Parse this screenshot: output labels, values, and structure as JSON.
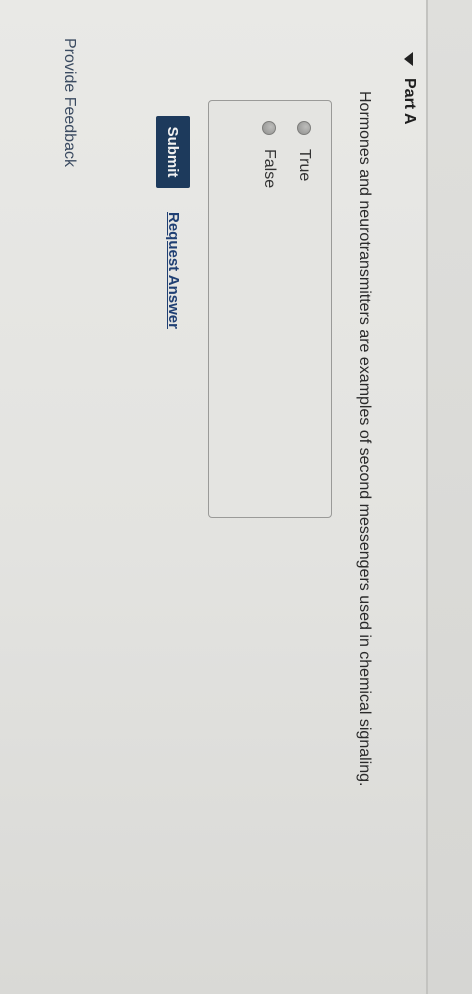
{
  "part": {
    "title": "Part A",
    "question": "Hormones and neurotransmitters are examples of second messengers used in chemical signaling."
  },
  "options": [
    {
      "label": "True"
    },
    {
      "label": "False"
    }
  ],
  "actions": {
    "submit_label": "Submit",
    "request_answer_label": "Request Answer"
  },
  "footer": {
    "feedback_label": "Provide Feedback"
  },
  "colors": {
    "submit_bg": "#1d3a5c",
    "link": "#1f3f73"
  }
}
